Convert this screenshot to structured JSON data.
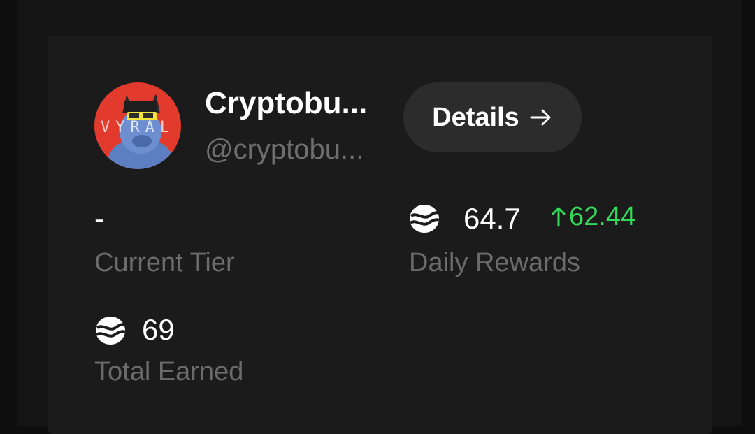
{
  "profile": {
    "name": "Cryptobu...",
    "handle": "@cryptobu...",
    "avatar_text": "VYRAL"
  },
  "details_button": {
    "label": "Details",
    "icon": "arrow-right-icon"
  },
  "stats": {
    "current_tier": {
      "value": "-",
      "label": "Current Tier"
    },
    "daily_rewards": {
      "value": "64.7",
      "change": "62.44",
      "change_direction": "up",
      "label": "Daily Rewards",
      "icon": "token-icon"
    },
    "total_earned": {
      "value": "69",
      "label": "Total Earned",
      "icon": "token-icon"
    }
  },
  "colors": {
    "background": "#0e0e0e",
    "card": "#1b1b1b",
    "button": "#2c2c2c",
    "positive": "#33d95a",
    "muted_text": "#6b6b6b"
  }
}
